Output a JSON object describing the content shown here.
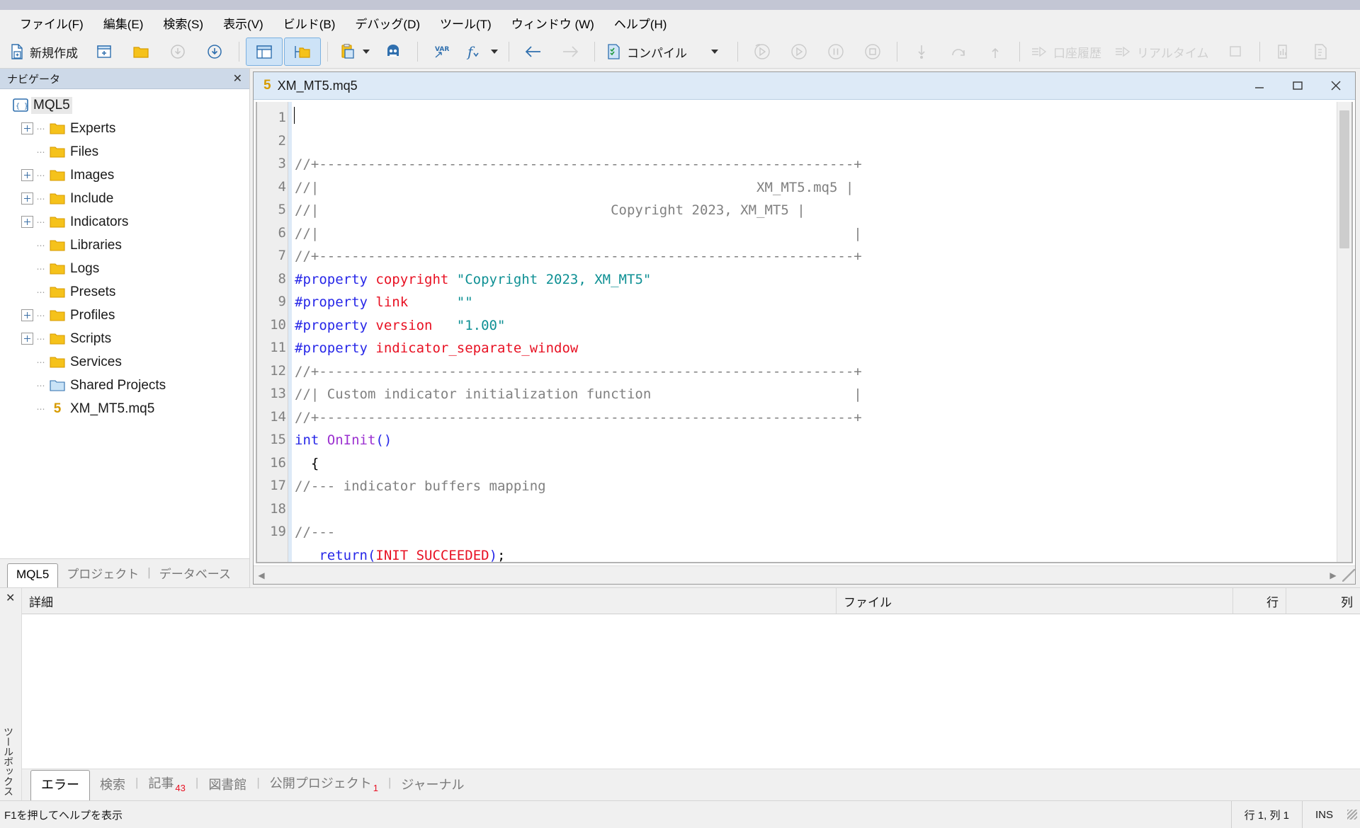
{
  "window": {
    "title_dot": ""
  },
  "menubar": {
    "items": [
      {
        "label": "ファイル(F)",
        "name": "menu-file"
      },
      {
        "label": "編集(E)",
        "name": "menu-edit"
      },
      {
        "label": "検索(S)",
        "name": "menu-search"
      },
      {
        "label": "表示(V)",
        "name": "menu-view"
      },
      {
        "label": "ビルド(B)",
        "name": "menu-build"
      },
      {
        "label": "デバッグ(D)",
        "name": "menu-debug"
      },
      {
        "label": "ツール(T)",
        "name": "menu-tools"
      },
      {
        "label": "ウィンドウ (W)",
        "name": "menu-window"
      },
      {
        "label": "ヘルプ(H)",
        "name": "menu-help"
      }
    ]
  },
  "toolbar": {
    "new_label": "新規作成",
    "compile_label": "コンパイル",
    "account_history_label": "口座履歴",
    "realtime_label": "リアルタイム"
  },
  "navigator": {
    "title": "ナビゲータ",
    "close": "✕",
    "root": "MQL5",
    "items": [
      {
        "label": "Experts",
        "expandable": true,
        "icon": "folder-yellow"
      },
      {
        "label": "Files",
        "expandable": false,
        "icon": "folder-yellow"
      },
      {
        "label": "Images",
        "expandable": true,
        "icon": "folder-yellow"
      },
      {
        "label": "Include",
        "expandable": true,
        "icon": "folder-yellow"
      },
      {
        "label": "Indicators",
        "expandable": true,
        "icon": "folder-yellow"
      },
      {
        "label": "Libraries",
        "expandable": false,
        "icon": "folder-yellow"
      },
      {
        "label": "Logs",
        "expandable": false,
        "icon": "folder-yellow"
      },
      {
        "label": "Presets",
        "expandable": false,
        "icon": "folder-yellow"
      },
      {
        "label": "Profiles",
        "expandable": true,
        "icon": "folder-yellow"
      },
      {
        "label": "Scripts",
        "expandable": true,
        "icon": "folder-yellow"
      },
      {
        "label": "Services",
        "expandable": false,
        "icon": "folder-yellow"
      },
      {
        "label": "Shared Projects",
        "expandable": false,
        "icon": "folder-blue"
      },
      {
        "label": "XM_MT5.mq5",
        "expandable": false,
        "icon": "mq5-badge",
        "badge": "5"
      }
    ],
    "tabs": [
      {
        "label": "MQL5",
        "active": true
      },
      {
        "label": "プロジェクト",
        "active": false
      },
      {
        "label": "データベース",
        "active": false
      }
    ]
  },
  "editor": {
    "tab": {
      "badge": "5",
      "filename": "XM_MT5.mq5"
    },
    "window_buttons": {
      "minimize": "minimize-icon",
      "maximize": "maximize-icon",
      "close": "close-icon"
    },
    "first_line": 1,
    "lines": [
      {
        "n": 1,
        "tokens": [
          {
            "t": "//+------------------------------------------------------------------+",
            "c": "cm"
          }
        ]
      },
      {
        "n": 2,
        "tokens": [
          {
            "t": "//|                                                      XM_MT5.mq5 |",
            "c": "cm"
          }
        ]
      },
      {
        "n": 3,
        "tokens": [
          {
            "t": "//|                                    Copyright 2023, XM_MT5 |",
            "c": "cm"
          }
        ]
      },
      {
        "n": 4,
        "tokens": [
          {
            "t": "//|                                                                  |",
            "c": "cm"
          }
        ]
      },
      {
        "n": 5,
        "tokens": [
          {
            "t": "//+------------------------------------------------------------------+",
            "c": "cm"
          }
        ]
      },
      {
        "n": 6,
        "tokens": [
          {
            "t": "#property ",
            "c": "pp"
          },
          {
            "t": "copyright ",
            "c": "id"
          },
          {
            "t": "\"Copyright 2023, XM_MT5\"",
            "c": "str"
          }
        ]
      },
      {
        "n": 7,
        "tokens": [
          {
            "t": "#property ",
            "c": "pp"
          },
          {
            "t": "link",
            "c": "id"
          },
          {
            "t": "      ",
            "c": "op"
          },
          {
            "t": "\"\"",
            "c": "str"
          }
        ]
      },
      {
        "n": 8,
        "tokens": [
          {
            "t": "#property ",
            "c": "pp"
          },
          {
            "t": "version",
            "c": "id"
          },
          {
            "t": "   ",
            "c": "op"
          },
          {
            "t": "\"1.00\"",
            "c": "str"
          }
        ]
      },
      {
        "n": 9,
        "tokens": [
          {
            "t": "#property ",
            "c": "pp"
          },
          {
            "t": "indicator_separate_window",
            "c": "id"
          }
        ]
      },
      {
        "n": 10,
        "tokens": [
          {
            "t": "//+------------------------------------------------------------------+",
            "c": "cm"
          }
        ]
      },
      {
        "n": 11,
        "tokens": [
          {
            "t": "//| Custom indicator initialization function                         |",
            "c": "cm"
          }
        ]
      },
      {
        "n": 12,
        "tokens": [
          {
            "t": "//+------------------------------------------------------------------+",
            "c": "cm"
          }
        ]
      },
      {
        "n": 13,
        "tokens": [
          {
            "t": "int ",
            "c": "kw"
          },
          {
            "t": "OnInit",
            "c": "fn"
          },
          {
            "t": "()",
            "c": "pp"
          }
        ]
      },
      {
        "n": 14,
        "tokens": [
          {
            "t": "  {",
            "c": "op"
          }
        ]
      },
      {
        "n": 15,
        "tokens": [
          {
            "t": "//--- indicator buffers mapping",
            "c": "cm"
          }
        ]
      },
      {
        "n": 16,
        "tokens": [
          {
            "t": "",
            "c": "op"
          }
        ]
      },
      {
        "n": 17,
        "tokens": [
          {
            "t": "//---",
            "c": "cm"
          }
        ]
      },
      {
        "n": 18,
        "tokens": [
          {
            "t": "   ",
            "c": "op"
          },
          {
            "t": "return",
            "c": "kw"
          },
          {
            "t": "(",
            "c": "pp"
          },
          {
            "t": "INIT_SUCCEEDED",
            "c": "id"
          },
          {
            "t": ")",
            "c": "pp"
          },
          {
            "t": ";",
            "c": "op"
          }
        ]
      },
      {
        "n": 19,
        "tokens": [
          {
            "t": "  }",
            "c": "op"
          }
        ]
      }
    ]
  },
  "toolbox": {
    "side_label": "ツールボックス",
    "close": "✕",
    "columns": [
      {
        "label": "詳細",
        "key": "detail"
      },
      {
        "label": "ファイル",
        "key": "file"
      },
      {
        "label": "行",
        "key": "line"
      },
      {
        "label": "列",
        "key": "col"
      }
    ],
    "rows": [],
    "tabs": [
      {
        "label": "エラー",
        "badge": "",
        "active": true
      },
      {
        "label": "検索",
        "badge": "",
        "active": false
      },
      {
        "label": "記事",
        "badge": "43",
        "active": false
      },
      {
        "label": "図書館",
        "badge": "",
        "active": false
      },
      {
        "label": "公開プロジェクト",
        "badge": "1",
        "active": false
      },
      {
        "label": "ジャーナル",
        "badge": "",
        "active": false
      }
    ]
  },
  "statusbar": {
    "hint": "F1を押してヘルプを表示",
    "position": "行 1, 列 1",
    "insert_mode": "INS"
  },
  "colors": {
    "accent": "#d79b00",
    "comment": "#808080",
    "preprocessor": "#2727e8",
    "identifier": "#e81123",
    "string": "#0e9094",
    "function": "#9b30d0",
    "tab_bg": "#ddeaf7",
    "nav_header": "#cdd9e8"
  }
}
